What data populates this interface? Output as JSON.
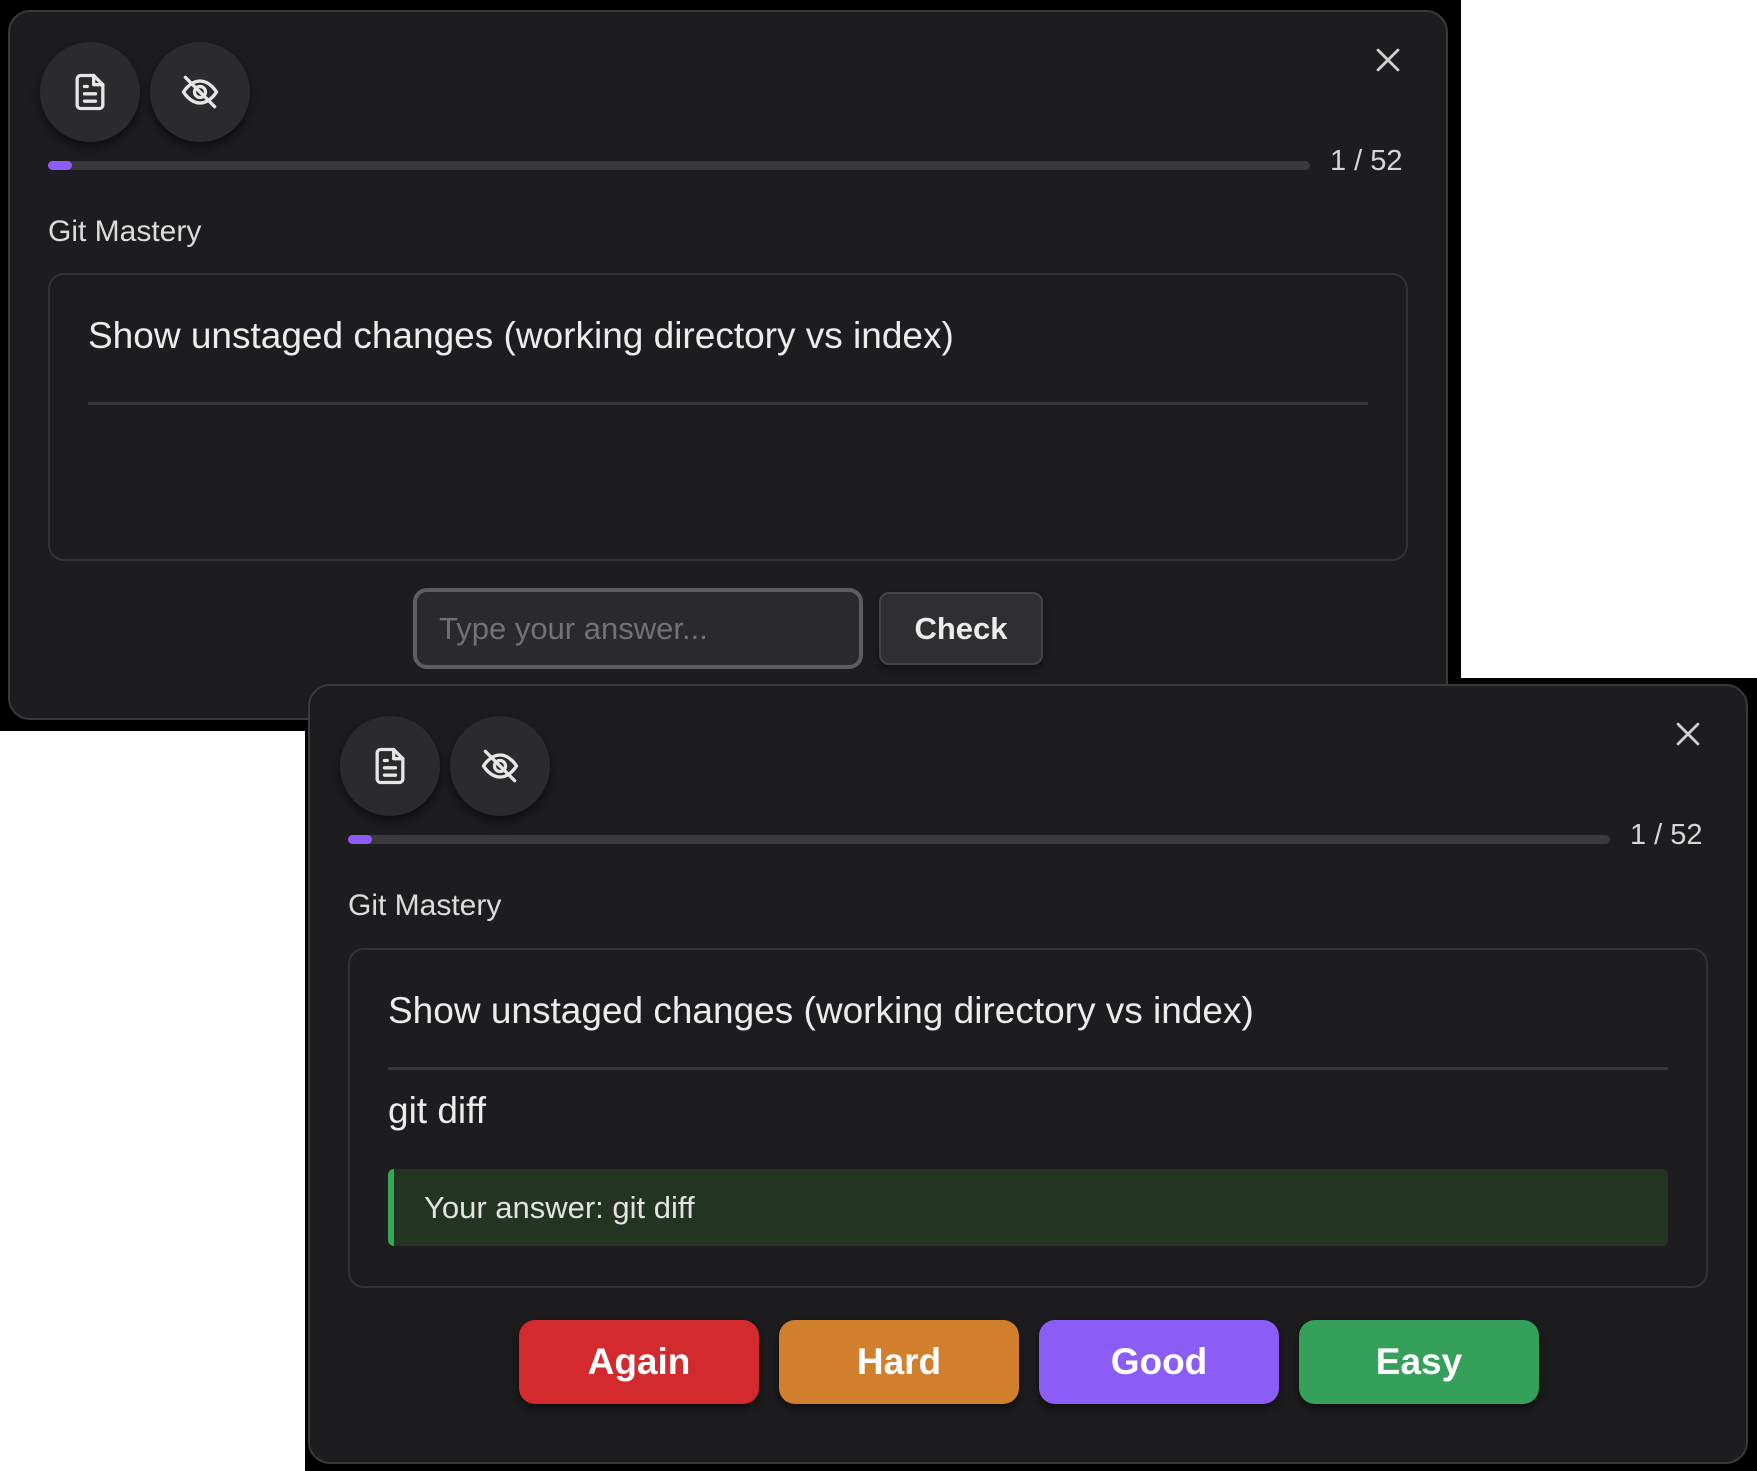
{
  "colors": {
    "accent": "#8b5cf6",
    "again": "#d32a2e",
    "hard": "#d17f2d",
    "good": "#8b5cf6",
    "easy": "#34a05a",
    "correct": "#34a853"
  },
  "icons": {
    "notes": "document-icon",
    "hide": "eye-off-icon",
    "close": "close-icon"
  },
  "front_panel": {
    "progress": {
      "current": 1,
      "total": 52,
      "label": "1 / 52",
      "fraction": 0.019
    },
    "deck_name": "Git Mastery",
    "question": "Show unstaged changes (working directory vs index)",
    "answer_input": {
      "value": "",
      "placeholder": "Type your answer..."
    },
    "check_label": "Check"
  },
  "back_panel": {
    "progress": {
      "current": 1,
      "total": 52,
      "label": "1 / 52",
      "fraction": 0.019
    },
    "deck_name": "Git Mastery",
    "question": "Show unstaged changes (working directory vs index)",
    "answer": "git diff",
    "feedback": "Your answer: git diff",
    "ratings": {
      "again": "Again",
      "hard": "Hard",
      "good": "Good",
      "easy": "Easy"
    }
  }
}
